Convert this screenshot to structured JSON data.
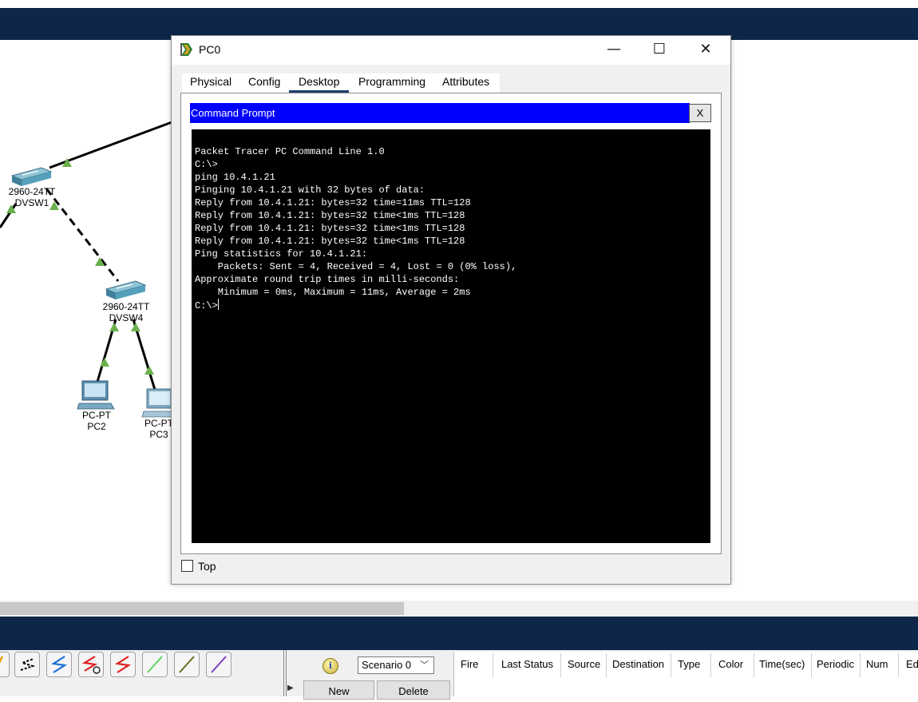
{
  "dialog": {
    "title": "PC0",
    "controls": {
      "minimize": "—",
      "maximize": "☐",
      "close": "✕"
    },
    "tabs": [
      "Physical",
      "Config",
      "Desktop",
      "Programming",
      "Attributes"
    ],
    "active_tab": "Desktop",
    "command_prompt": {
      "title": "Command Prompt",
      "close_label": "X",
      "lines": [
        "Packet Tracer PC Command Line 1.0",
        "C:\\>",
        "",
        "",
        "ping 10.4.1.21",
        "",
        "Pinging 10.4.1.21 with 32 bytes of data:",
        "",
        "Reply from 10.4.1.21: bytes=32 time=11ms TTL=128",
        "Reply from 10.4.1.21: bytes=32 time<1ms TTL=128",
        "Reply from 10.4.1.21: bytes=32 time<1ms TTL=128",
        "Reply from 10.4.1.21: bytes=32 time<1ms TTL=128",
        "",
        "Ping statistics for 10.4.1.21:",
        "    Packets: Sent = 4, Received = 4, Lost = 0 (0% loss),",
        "Approximate round trip times in milli-seconds:",
        "    Minimum = 0ms, Maximum = 11ms, Average = 2ms",
        ""
      ],
      "prompt": "C:\\>"
    },
    "top_checkbox_label": "Top",
    "top_checked": false
  },
  "topology": {
    "switch_dvsw1": {
      "model": "2960-24TT",
      "name": "DVSW1"
    },
    "switch_dvsw4": {
      "model": "2960-24TT",
      "name": "DVSW4"
    },
    "pc2": {
      "model": "PC-PT",
      "name": "PC2"
    },
    "pc3": {
      "model": "PC-PT",
      "name": "PC3"
    }
  },
  "bottom_panel": {
    "scenario": "Scenario 0",
    "new_label": "New",
    "delete_label": "Delete",
    "pdu_columns": [
      "Fire",
      "Last Status",
      "Source",
      "Destination",
      "Type",
      "Color",
      "Time(sec)",
      "Periodic",
      "Num",
      "Ed"
    ]
  },
  "colors": {
    "navy_bar": "#0e2748",
    "prompt_titlebar": "#0000ff",
    "terminal_bg": "#000000",
    "link_indicator": "#6ab04c"
  }
}
